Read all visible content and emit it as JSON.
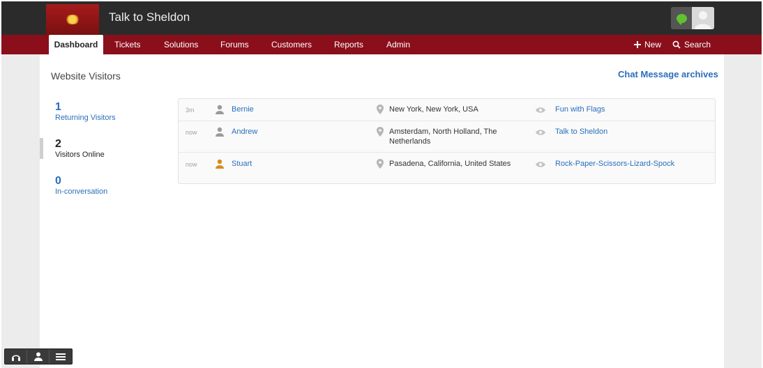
{
  "app": {
    "title": "Talk to Sheldon"
  },
  "nav": {
    "tabs": [
      {
        "label": "Dashboard",
        "active": true
      },
      {
        "label": "Tickets"
      },
      {
        "label": "Solutions"
      },
      {
        "label": "Forums"
      },
      {
        "label": "Customers"
      },
      {
        "label": "Reports"
      },
      {
        "label": "Admin"
      }
    ],
    "new_label": "New",
    "search_label": "Search"
  },
  "page": {
    "heading": "Website Visitors",
    "archives_link": "Chat Message archives"
  },
  "stats": [
    {
      "count": "1",
      "label": "Returning Visitors"
    },
    {
      "count": "2",
      "label": "Visitors Online"
    },
    {
      "count": "0",
      "label": "In-conversation"
    }
  ],
  "visitors": [
    {
      "time": "3m",
      "name": "Bernie",
      "location": "New York, New York, USA",
      "page": "Fun with Flags",
      "icon_color": "#9a9a9a"
    },
    {
      "time": "now",
      "name": "Andrew",
      "location": "Amsterdam, North Holland, The Netherlands",
      "page": "Talk to Sheldon",
      "icon_color": "#9a9a9a"
    },
    {
      "time": "now",
      "name": "Stuart",
      "location": "Pasadena, California, United States",
      "page": "Rock-Paper-Scissors-Lizard-Spock",
      "icon_color": "#d98b1a"
    }
  ],
  "icons": {
    "chat": "chat-bubble-icon",
    "avatar": "user-avatar",
    "new": "plus-icon",
    "search": "search-icon",
    "toolbar": [
      "headset-icon",
      "person-icon",
      "menu-icon"
    ]
  },
  "colors": {
    "brand_red": "#8a0f1b",
    "link_blue": "#2a6ebb",
    "chat_green": "#5fc22f"
  }
}
